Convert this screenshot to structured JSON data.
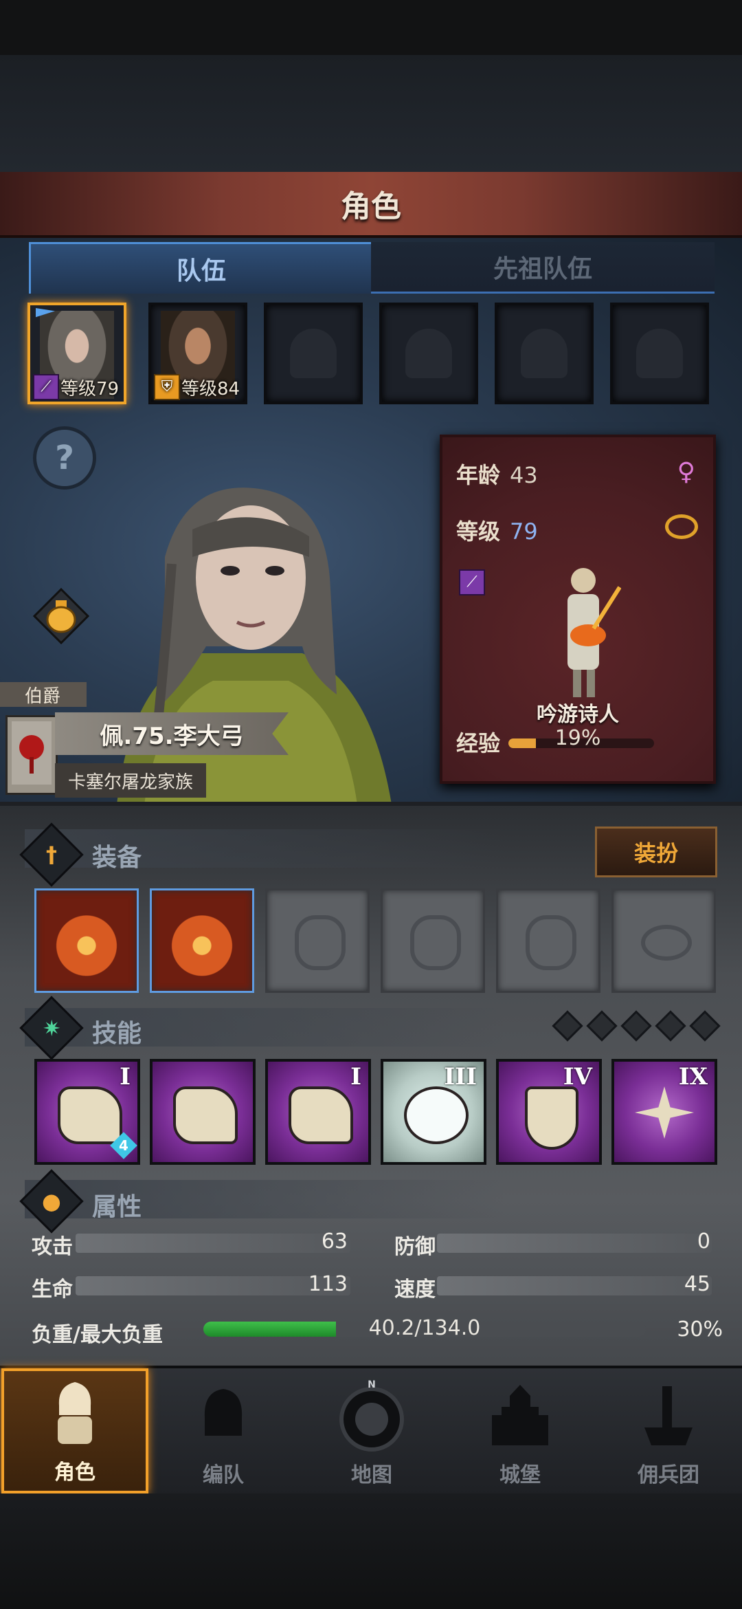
{
  "header": {
    "title": "角色"
  },
  "tabs": [
    {
      "label": "队伍",
      "active": true
    },
    {
      "label": "先祖队伍",
      "active": false
    }
  ],
  "party": [
    {
      "level_text": "等级79",
      "class_icon": "staff-icon",
      "selected": true
    },
    {
      "level_text": "等级84",
      "class_icon": "shield-icon",
      "selected": false
    },
    {
      "empty": true
    },
    {
      "empty": true
    },
    {
      "empty": true
    },
    {
      "empty": true
    }
  ],
  "hero": {
    "rank": "伯爵",
    "name": "佩.75.李大弓",
    "family": "卡塞尔屠龙家族"
  },
  "card": {
    "age_label": "年龄",
    "age": "43",
    "level_label": "等级",
    "level": "79",
    "sex_icon": "female-icon",
    "class_name": "吟游诗人",
    "exp_label": "经验",
    "exp_pct_text": "19%",
    "exp_fraction": 0.19
  },
  "equipment": {
    "title": "装备",
    "dress_button": "装扮",
    "slots": [
      {
        "item": "flame-lute-icon",
        "equipped": true
      },
      {
        "item": "flame-lute-icon",
        "equipped": true
      },
      {
        "item": "helmet-icon",
        "equipped": false
      },
      {
        "item": "armor-icon",
        "equipped": false
      },
      {
        "item": "boots-icon",
        "equipped": false
      },
      {
        "item": "ring-icon",
        "equipped": false
      }
    ]
  },
  "skills": {
    "title": "技能",
    "list": [
      {
        "icon": "music-note-icon",
        "rank": "I",
        "badge": "4",
        "style": "purple"
      },
      {
        "icon": "crystal-note-icon",
        "rank": "",
        "style": "purple"
      },
      {
        "icon": "crystal-hand-icon",
        "rank": "I",
        "style": "purple"
      },
      {
        "icon": "burst-icon",
        "rank": "III",
        "style": "light"
      },
      {
        "icon": "shield-skill-icon",
        "rank": "IV",
        "style": "purple"
      },
      {
        "icon": "cross-star-icon",
        "rank": "IX",
        "style": "purple"
      }
    ]
  },
  "attributes": {
    "title": "属性",
    "attack_label": "攻击",
    "attack": "63",
    "defense_label": "防御",
    "defense": "0",
    "hp_label": "生命",
    "hp": "113",
    "speed_label": "速度",
    "speed": "45",
    "weight_label": "负重/最大负重",
    "weight_text": "40.2/134.0",
    "weight_pct": "30%",
    "weight_fraction": 0.3
  },
  "nav": [
    {
      "label": "角色",
      "icon": "knight-icon",
      "active": true
    },
    {
      "label": "编队",
      "icon": "helmet-group-icon",
      "active": false
    },
    {
      "label": "地图",
      "icon": "compass-icon",
      "active": false,
      "compass_n": "N"
    },
    {
      "label": "城堡",
      "icon": "castle-icon",
      "active": false
    },
    {
      "label": "佣兵团",
      "icon": "mercenary-icon",
      "active": false
    }
  ],
  "colors": {
    "accent": "#f2a02a",
    "tab_blue": "#4f90d8",
    "card_red": "#4a1e22"
  }
}
